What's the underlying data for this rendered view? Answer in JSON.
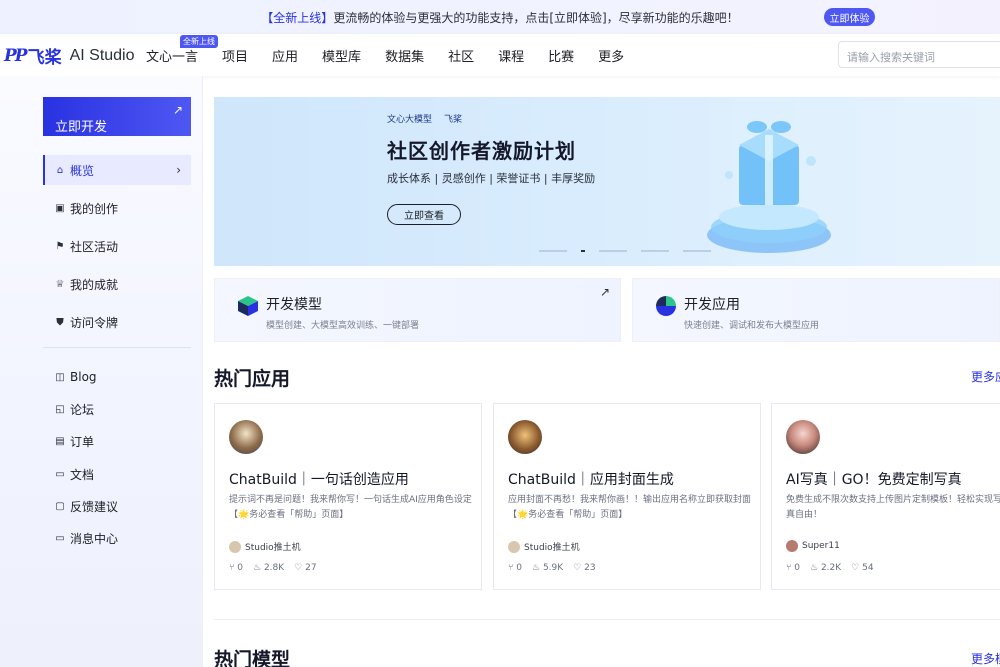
{
  "announcement": {
    "highlight": "【全新上线】",
    "text": "更流畅的体验与更强大的功能支持，点击[立即体验]，尽享新功能的乐趣吧！",
    "button": "立即体验"
  },
  "nav": {
    "logo_pp": "PP",
    "logo_feijiang": "飞桨",
    "logo_studio": "AI Studio",
    "items": [
      "文心一言",
      "项目",
      "应用",
      "模型库",
      "数据集",
      "社区",
      "课程",
      "比赛",
      "更多"
    ],
    "new_badge": "全新上线",
    "search_placeholder": "请输入搜索关键词"
  },
  "sidebar": {
    "dev_button": "立即开发",
    "dev_arrow": "↗",
    "items": [
      {
        "label": "概览",
        "icon": "home-icon"
      },
      {
        "label": "我的创作",
        "icon": "box-icon"
      },
      {
        "label": "社区活动",
        "icon": "flag-icon"
      },
      {
        "label": "我的成就",
        "icon": "trophy-icon"
      },
      {
        "label": "访问令牌",
        "icon": "shield-icon"
      }
    ],
    "links": [
      {
        "label": "Blog",
        "icon": "book-icon"
      },
      {
        "label": "论坛",
        "icon": "chat-icon"
      },
      {
        "label": "订单",
        "icon": "receipt-icon"
      },
      {
        "label": "文档",
        "icon": "folder-icon"
      },
      {
        "label": "反馈建议",
        "icon": "feedback-icon"
      },
      {
        "label": "消息中心",
        "icon": "message-icon"
      }
    ]
  },
  "banner": {
    "brand1": "文心大模型",
    "brand2": "飞桨",
    "title": "社区创作者激励计划",
    "subtitle": "成长体系 | 灵感创作 | 荣誉证书 | 丰厚奖励",
    "cta": "立即查看"
  },
  "features": [
    {
      "title": "开发模型",
      "desc": "模型创建、大模型高效训练、一键部署",
      "arrow": "↗"
    },
    {
      "title": "开发应用",
      "desc": "快速创建、调试和发布大模型应用"
    }
  ],
  "hot_apps": {
    "title": "热门应用",
    "more": "更多应用",
    "cards": [
      {
        "title": "ChatBuild｜一句话创造应用",
        "desc": "提示词不再是问题！我来帮你写！一句话生成AI应用角色设定【🌟务必查看「帮助」页面】",
        "author": "Studio推土机",
        "stat1": "0",
        "stat2": "2.8K",
        "stat3": "27"
      },
      {
        "title": "ChatBuild｜应用封面生成",
        "desc": "应用封面不再愁！我来帮你画！！输出应用名称立即获取封面【🌟务必查看「帮助」页面】",
        "author": "Studio推土机",
        "stat1": "0",
        "stat2": "5.9K",
        "stat3": "23"
      },
      {
        "title": "AI写真｜GO！免费定制写真",
        "desc": "免费生成不限次数支持上传图片定制模板！轻松实现写真自由！",
        "author": "Super11",
        "stat1": "0",
        "stat2": "2.2K",
        "stat3": "54"
      }
    ]
  },
  "hot_models": {
    "title": "热门模型",
    "more": "更多模型"
  }
}
